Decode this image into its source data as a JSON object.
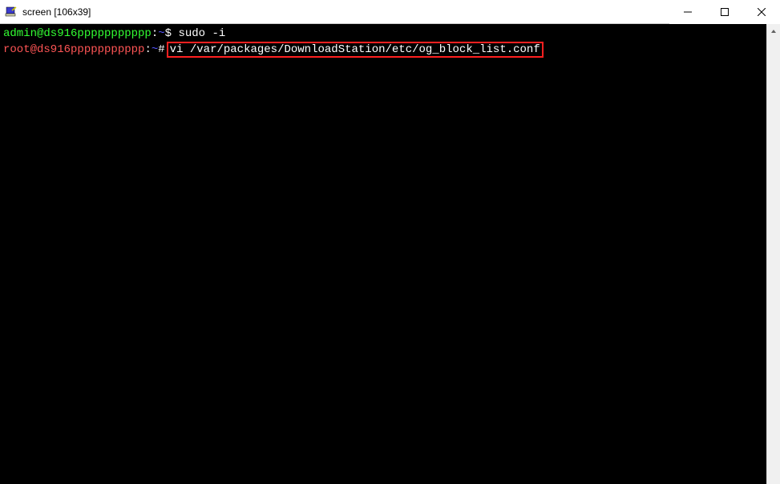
{
  "window": {
    "title": "screen [106x39]"
  },
  "terminal": {
    "line1": {
      "user": "admin@ds916ppppppppppp",
      "sep1": ":",
      "path": "~",
      "prompt": "$",
      "cmd": "sudo -i"
    },
    "line2": {
      "user": "root@ds916ppppppppppp",
      "sep1": ":",
      "path": "~",
      "prompt": "#",
      "cmd": "vi /var/packages/DownloadStation/etc/og_block_list.conf"
    }
  }
}
